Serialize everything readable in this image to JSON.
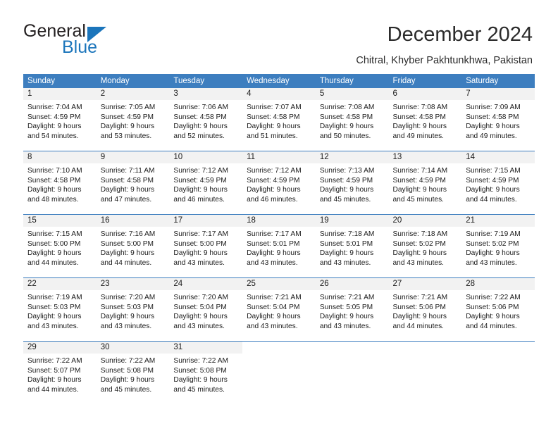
{
  "brand": {
    "name_part1": "General",
    "name_part2": "Blue",
    "triangle_color": "#1b75bb",
    "text_color": "#231f20"
  },
  "header": {
    "title": "December 2024",
    "subtitle": "Chitral, Khyber Pakhtunkhwa, Pakistan"
  },
  "colors": {
    "header_blue": "#3d7ebf",
    "date_band_gray": "#f2f2f2",
    "cell_white": "#ffffff",
    "text": "#1a1a1a"
  },
  "weekday_headers": [
    "Sunday",
    "Monday",
    "Tuesday",
    "Wednesday",
    "Thursday",
    "Friday",
    "Saturday"
  ],
  "labels": {
    "sunrise_prefix": "Sunrise:",
    "sunset_prefix": "Sunset:",
    "daylight_prefix": "Daylight:"
  },
  "weeks": [
    [
      {
        "date": "1",
        "sunrise": "Sunrise: 7:04 AM",
        "sunset": "Sunset: 4:59 PM",
        "daylight_line1": "Daylight: 9 hours",
        "daylight_line2": "and 54 minutes."
      },
      {
        "date": "2",
        "sunrise": "Sunrise: 7:05 AM",
        "sunset": "Sunset: 4:59 PM",
        "daylight_line1": "Daylight: 9 hours",
        "daylight_line2": "and 53 minutes."
      },
      {
        "date": "3",
        "sunrise": "Sunrise: 7:06 AM",
        "sunset": "Sunset: 4:58 PM",
        "daylight_line1": "Daylight: 9 hours",
        "daylight_line2": "and 52 minutes."
      },
      {
        "date": "4",
        "sunrise": "Sunrise: 7:07 AM",
        "sunset": "Sunset: 4:58 PM",
        "daylight_line1": "Daylight: 9 hours",
        "daylight_line2": "and 51 minutes."
      },
      {
        "date": "5",
        "sunrise": "Sunrise: 7:08 AM",
        "sunset": "Sunset: 4:58 PM",
        "daylight_line1": "Daylight: 9 hours",
        "daylight_line2": "and 50 minutes."
      },
      {
        "date": "6",
        "sunrise": "Sunrise: 7:08 AM",
        "sunset": "Sunset: 4:58 PM",
        "daylight_line1": "Daylight: 9 hours",
        "daylight_line2": "and 49 minutes."
      },
      {
        "date": "7",
        "sunrise": "Sunrise: 7:09 AM",
        "sunset": "Sunset: 4:58 PM",
        "daylight_line1": "Daylight: 9 hours",
        "daylight_line2": "and 49 minutes."
      }
    ],
    [
      {
        "date": "8",
        "sunrise": "Sunrise: 7:10 AM",
        "sunset": "Sunset: 4:58 PM",
        "daylight_line1": "Daylight: 9 hours",
        "daylight_line2": "and 48 minutes."
      },
      {
        "date": "9",
        "sunrise": "Sunrise: 7:11 AM",
        "sunset": "Sunset: 4:58 PM",
        "daylight_line1": "Daylight: 9 hours",
        "daylight_line2": "and 47 minutes."
      },
      {
        "date": "10",
        "sunrise": "Sunrise: 7:12 AM",
        "sunset": "Sunset: 4:59 PM",
        "daylight_line1": "Daylight: 9 hours",
        "daylight_line2": "and 46 minutes."
      },
      {
        "date": "11",
        "sunrise": "Sunrise: 7:12 AM",
        "sunset": "Sunset: 4:59 PM",
        "daylight_line1": "Daylight: 9 hours",
        "daylight_line2": "and 46 minutes."
      },
      {
        "date": "12",
        "sunrise": "Sunrise: 7:13 AM",
        "sunset": "Sunset: 4:59 PM",
        "daylight_line1": "Daylight: 9 hours",
        "daylight_line2": "and 45 minutes."
      },
      {
        "date": "13",
        "sunrise": "Sunrise: 7:14 AM",
        "sunset": "Sunset: 4:59 PM",
        "daylight_line1": "Daylight: 9 hours",
        "daylight_line2": "and 45 minutes."
      },
      {
        "date": "14",
        "sunrise": "Sunrise: 7:15 AM",
        "sunset": "Sunset: 4:59 PM",
        "daylight_line1": "Daylight: 9 hours",
        "daylight_line2": "and 44 minutes."
      }
    ],
    [
      {
        "date": "15",
        "sunrise": "Sunrise: 7:15 AM",
        "sunset": "Sunset: 5:00 PM",
        "daylight_line1": "Daylight: 9 hours",
        "daylight_line2": "and 44 minutes."
      },
      {
        "date": "16",
        "sunrise": "Sunrise: 7:16 AM",
        "sunset": "Sunset: 5:00 PM",
        "daylight_line1": "Daylight: 9 hours",
        "daylight_line2": "and 44 minutes."
      },
      {
        "date": "17",
        "sunrise": "Sunrise: 7:17 AM",
        "sunset": "Sunset: 5:00 PM",
        "daylight_line1": "Daylight: 9 hours",
        "daylight_line2": "and 43 minutes."
      },
      {
        "date": "18",
        "sunrise": "Sunrise: 7:17 AM",
        "sunset": "Sunset: 5:01 PM",
        "daylight_line1": "Daylight: 9 hours",
        "daylight_line2": "and 43 minutes."
      },
      {
        "date": "19",
        "sunrise": "Sunrise: 7:18 AM",
        "sunset": "Sunset: 5:01 PM",
        "daylight_line1": "Daylight: 9 hours",
        "daylight_line2": "and 43 minutes."
      },
      {
        "date": "20",
        "sunrise": "Sunrise: 7:18 AM",
        "sunset": "Sunset: 5:02 PM",
        "daylight_line1": "Daylight: 9 hours",
        "daylight_line2": "and 43 minutes."
      },
      {
        "date": "21",
        "sunrise": "Sunrise: 7:19 AM",
        "sunset": "Sunset: 5:02 PM",
        "daylight_line1": "Daylight: 9 hours",
        "daylight_line2": "and 43 minutes."
      }
    ],
    [
      {
        "date": "22",
        "sunrise": "Sunrise: 7:19 AM",
        "sunset": "Sunset: 5:03 PM",
        "daylight_line1": "Daylight: 9 hours",
        "daylight_line2": "and 43 minutes."
      },
      {
        "date": "23",
        "sunrise": "Sunrise: 7:20 AM",
        "sunset": "Sunset: 5:03 PM",
        "daylight_line1": "Daylight: 9 hours",
        "daylight_line2": "and 43 minutes."
      },
      {
        "date": "24",
        "sunrise": "Sunrise: 7:20 AM",
        "sunset": "Sunset: 5:04 PM",
        "daylight_line1": "Daylight: 9 hours",
        "daylight_line2": "and 43 minutes."
      },
      {
        "date": "25",
        "sunrise": "Sunrise: 7:21 AM",
        "sunset": "Sunset: 5:04 PM",
        "daylight_line1": "Daylight: 9 hours",
        "daylight_line2": "and 43 minutes."
      },
      {
        "date": "26",
        "sunrise": "Sunrise: 7:21 AM",
        "sunset": "Sunset: 5:05 PM",
        "daylight_line1": "Daylight: 9 hours",
        "daylight_line2": "and 43 minutes."
      },
      {
        "date": "27",
        "sunrise": "Sunrise: 7:21 AM",
        "sunset": "Sunset: 5:06 PM",
        "daylight_line1": "Daylight: 9 hours",
        "daylight_line2": "and 44 minutes."
      },
      {
        "date": "28",
        "sunrise": "Sunrise: 7:22 AM",
        "sunset": "Sunset: 5:06 PM",
        "daylight_line1": "Daylight: 9 hours",
        "daylight_line2": "and 44 minutes."
      }
    ],
    [
      {
        "date": "29",
        "sunrise": "Sunrise: 7:22 AM",
        "sunset": "Sunset: 5:07 PM",
        "daylight_line1": "Daylight: 9 hours",
        "daylight_line2": "and 44 minutes."
      },
      {
        "date": "30",
        "sunrise": "Sunrise: 7:22 AM",
        "sunset": "Sunset: 5:08 PM",
        "daylight_line1": "Daylight: 9 hours",
        "daylight_line2": "and 45 minutes."
      },
      {
        "date": "31",
        "sunrise": "Sunrise: 7:22 AM",
        "sunset": "Sunset: 5:08 PM",
        "daylight_line1": "Daylight: 9 hours",
        "daylight_line2": "and 45 minutes."
      },
      {
        "date": "",
        "sunrise": "",
        "sunset": "",
        "daylight_line1": "",
        "daylight_line2": ""
      },
      {
        "date": "",
        "sunrise": "",
        "sunset": "",
        "daylight_line1": "",
        "daylight_line2": ""
      },
      {
        "date": "",
        "sunrise": "",
        "sunset": "",
        "daylight_line1": "",
        "daylight_line2": ""
      },
      {
        "date": "",
        "sunrise": "",
        "sunset": "",
        "daylight_line1": "",
        "daylight_line2": ""
      }
    ]
  ]
}
